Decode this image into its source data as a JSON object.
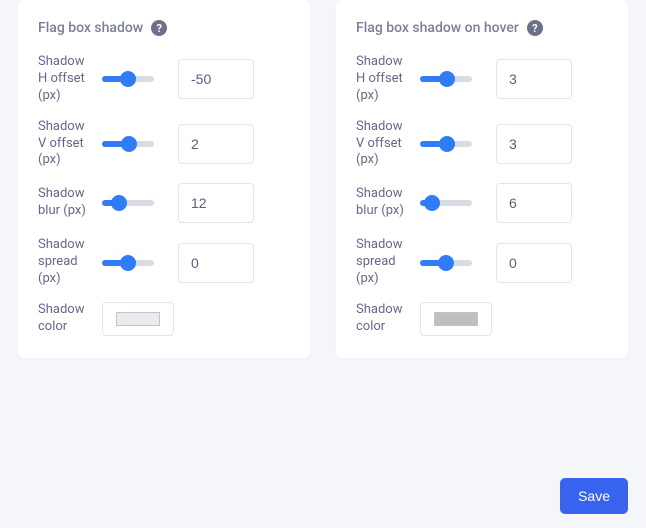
{
  "panels": {
    "normal": {
      "title": "Flag box shadow",
      "fields": {
        "h": {
          "label": "Shadow H offset (px)",
          "value": "-50",
          "min": -50,
          "max": 50
        },
        "v": {
          "label": "Shadow V offset (px)",
          "value": "2",
          "min": -50,
          "max": 50
        },
        "blur": {
          "label": "Shadow blur (px)",
          "value": "12",
          "min": 0,
          "max": 50
        },
        "spread": {
          "label": "Shadow spread (px)",
          "value": "0",
          "min": -50,
          "max": 50
        },
        "color": {
          "label": "Shadow color",
          "value": "#ebebeb"
        }
      }
    },
    "hover": {
      "title": "Flag box shadow on hover",
      "fields": {
        "h": {
          "label": "Shadow H offset (px)",
          "value": "3",
          "min": -50,
          "max": 50
        },
        "v": {
          "label": "Shadow V offset (px)",
          "value": "3",
          "min": -50,
          "max": 50
        },
        "blur": {
          "label": "Shadow blur (px)",
          "value": "6",
          "min": 0,
          "max": 50
        },
        "spread": {
          "label": "Shadow spread (px)",
          "value": "0",
          "min": -50,
          "max": 50
        },
        "color": {
          "label": "Shadow color",
          "value": "#bfbfbf"
        }
      }
    }
  },
  "help_glyph": "?",
  "save_label": "Save",
  "colors": {
    "accent": "#2f7cf6",
    "track": "#d9dbe6"
  }
}
